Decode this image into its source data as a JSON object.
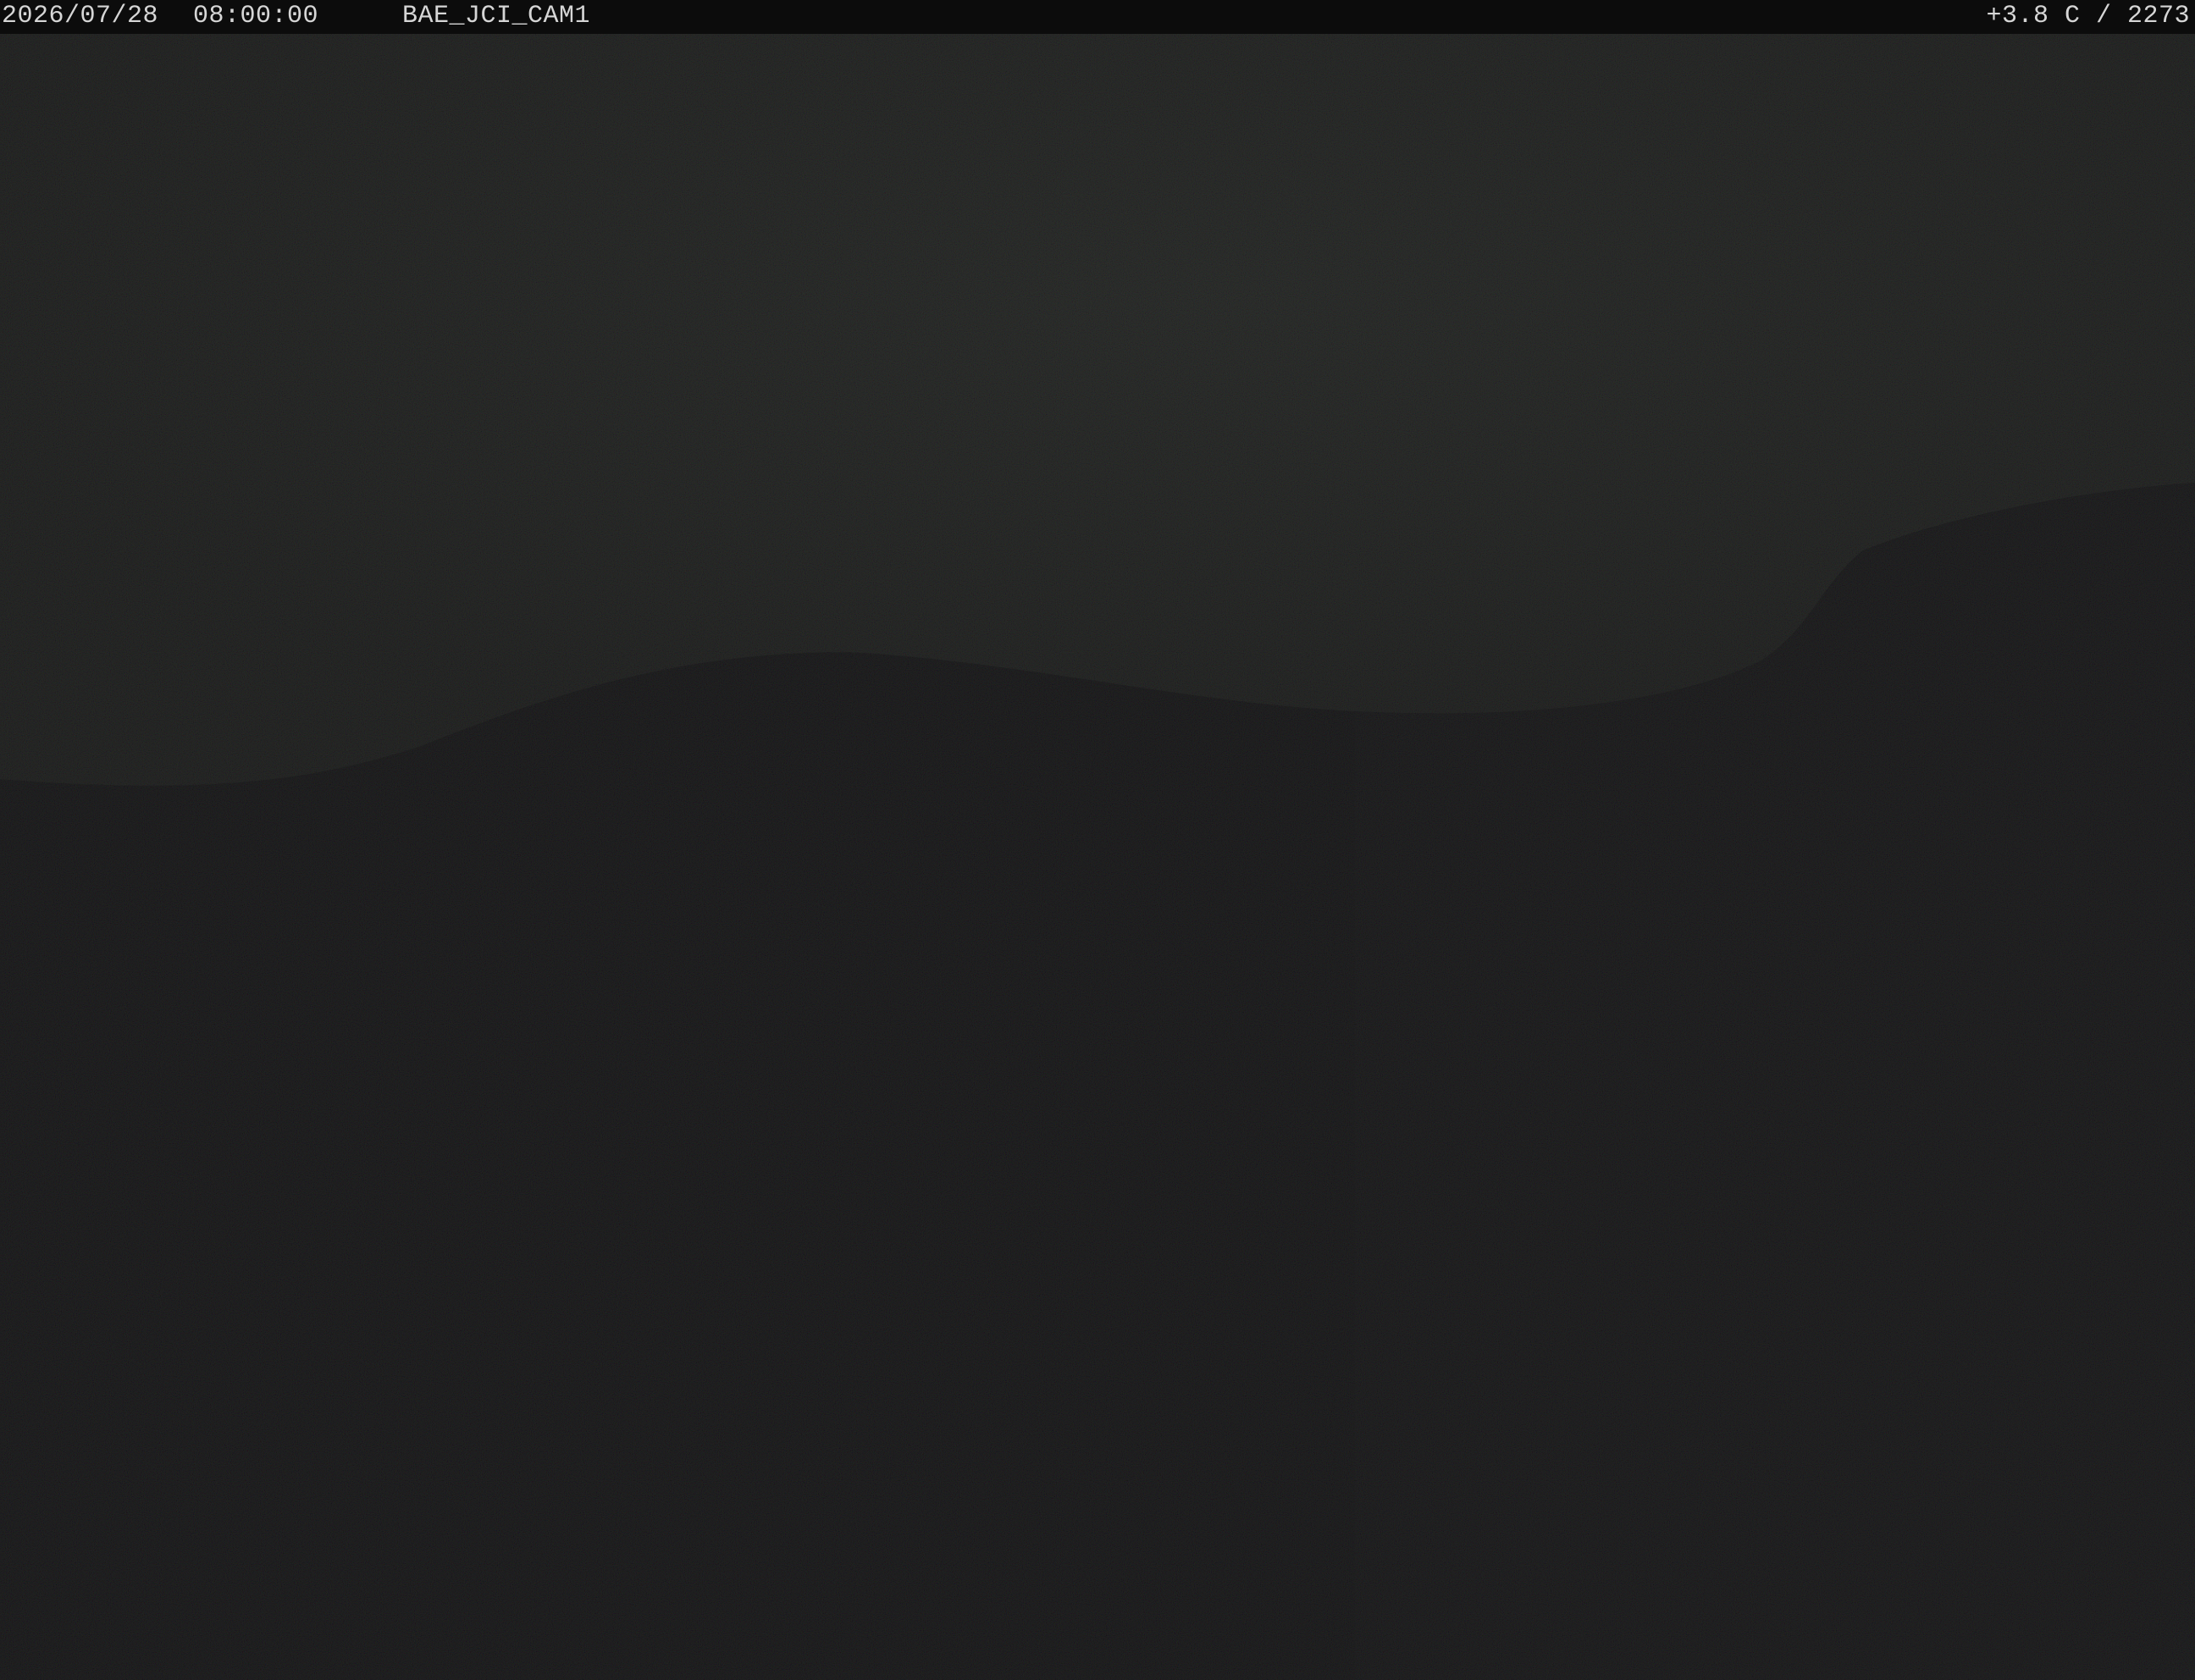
{
  "overlay": {
    "date": "2026/07/28",
    "time": "08:00:00",
    "camera_id": "BAE_JCI_CAM1",
    "reading": "+3.8 C / 2273"
  },
  "scene": {
    "description_colors": {
      "background": "#121213",
      "sky": "#1b1d1b",
      "slope": "#141414",
      "overlay_bar": "#0c0c0c",
      "overlay_text": "#d6d6d6"
    }
  }
}
